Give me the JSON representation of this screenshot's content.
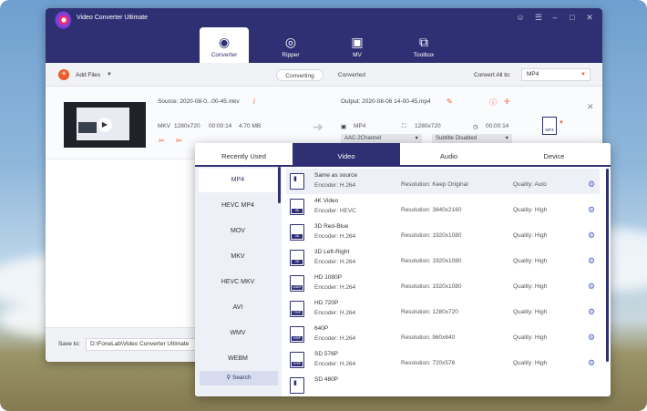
{
  "app": {
    "title": "Video Converter Ultimate"
  },
  "nav": {
    "tabs": [
      {
        "label": "Converter",
        "icon": "converter-icon"
      },
      {
        "label": "Ripper",
        "icon": "disc-icon"
      },
      {
        "label": "MV",
        "icon": "image-icon"
      },
      {
        "label": "Toolbox",
        "icon": "toolbox-icon"
      }
    ]
  },
  "toolbar": {
    "add_files": "Add Files",
    "converting": "Converting",
    "converted": "Converted",
    "convert_all_label": "Convert All to:",
    "convert_all_value": "MP4"
  },
  "file": {
    "source": "Source: 2020-08-0...00-45.mkv",
    "format": "MKV",
    "resolution": "1280x720",
    "duration": "00:00:14",
    "size": "4.70 MB",
    "output": "Output: 2020-08-06 14-00-45.mp4",
    "out_format": "MP4",
    "out_resolution": "1280x720",
    "out_duration": "00:00:14",
    "audio_track": "AAC-2Channel",
    "subtitle": "Subtitle Disabled",
    "badge": "MP4"
  },
  "bottom": {
    "save_to": "Save to:",
    "path": "D:\\FoneLab\\Video Converter Ultimate"
  },
  "popup": {
    "tabs": [
      "Recently Used",
      "Video",
      "Audio",
      "Device"
    ],
    "active_tab": "Video",
    "categories": [
      "MP4",
      "HEVC MP4",
      "MOV",
      "MKV",
      "HEVC MKV",
      "AVI",
      "WMV",
      "WEBM"
    ],
    "search": "Search",
    "presets": [
      {
        "name": "Same as source",
        "encoder": "Encoder: H.264",
        "resolution": "Resolution: Keep Original",
        "quality": "Quality: Auto",
        "tag": ""
      },
      {
        "name": "4K Video",
        "encoder": "Encoder: HEVC",
        "resolution": "Resolution: 3840x2160",
        "quality": "Quality: High",
        "tag": "4K"
      },
      {
        "name": "3D Red-Blue",
        "encoder": "Encoder: H.264",
        "resolution": "Resolution: 1920x1080",
        "quality": "Quality: High",
        "tag": "3D"
      },
      {
        "name": "3D Left-Right",
        "encoder": "Encoder: H.264",
        "resolution": "Resolution: 1920x1080",
        "quality": "Quality: High",
        "tag": "3D"
      },
      {
        "name": "HD 1080P",
        "encoder": "Encoder: H.264",
        "resolution": "Resolution: 1920x1080",
        "quality": "Quality: High",
        "tag": "1080P"
      },
      {
        "name": "HD 720P",
        "encoder": "Encoder: H.264",
        "resolution": "Resolution: 1280x720",
        "quality": "Quality: High",
        "tag": "720P"
      },
      {
        "name": "640P",
        "encoder": "Encoder: H.264",
        "resolution": "Resolution: 960x640",
        "quality": "Quality: High",
        "tag": "640P"
      },
      {
        "name": "SD 576P",
        "encoder": "Encoder: H.264",
        "resolution": "Resolution: 720x576",
        "quality": "Quality: High",
        "tag": "576P"
      },
      {
        "name": "SD 480P",
        "encoder": "",
        "resolution": "",
        "quality": "",
        "tag": ""
      }
    ]
  },
  "colors": {
    "brand": "#2f3073",
    "accent": "#ef5a2b",
    "gear": "#4a66c7"
  }
}
